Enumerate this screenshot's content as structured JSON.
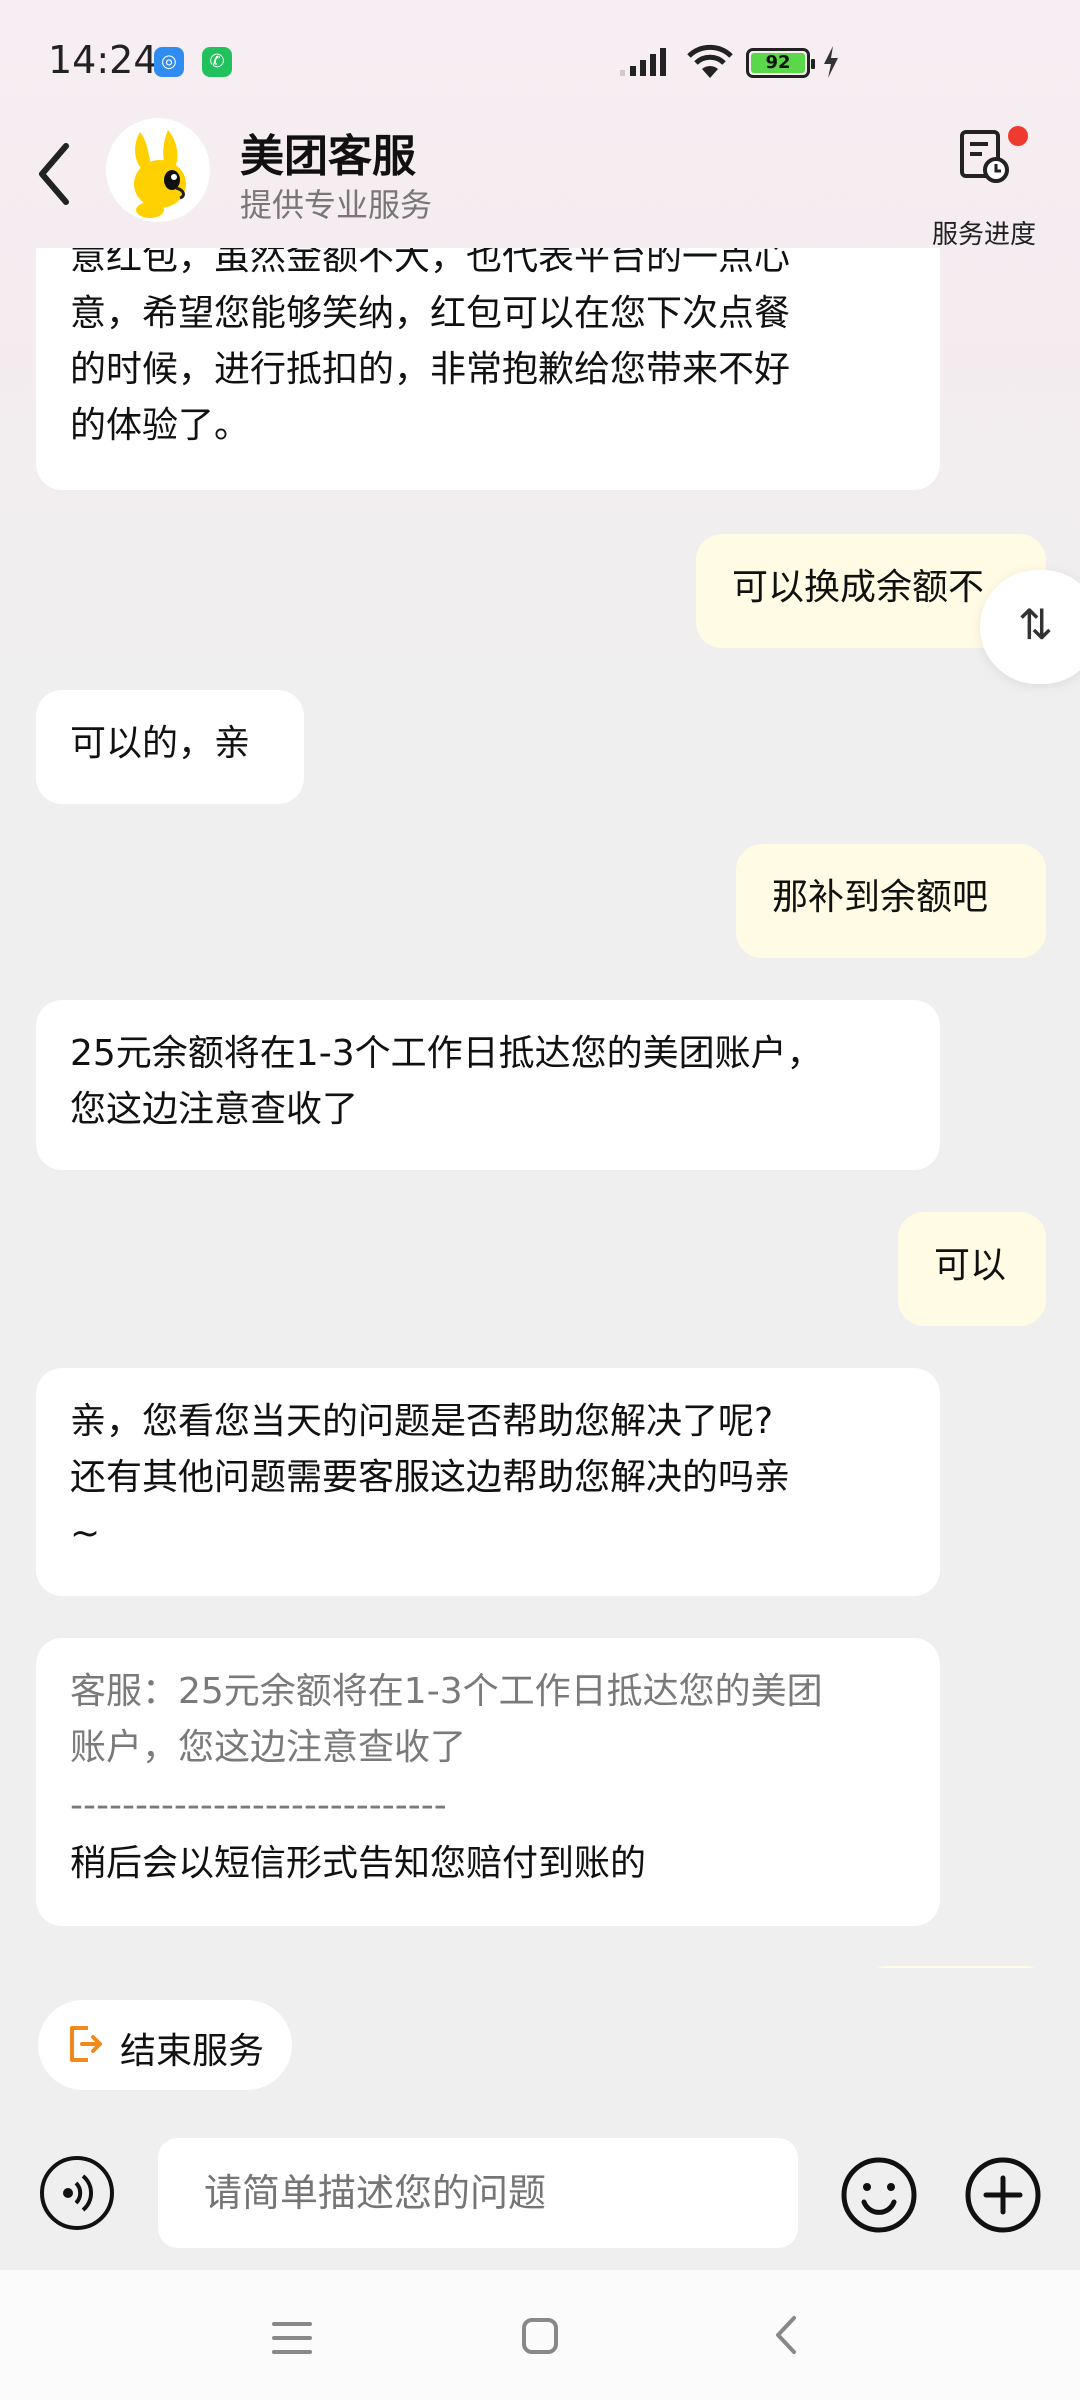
{
  "status_bar": {
    "time": "14:24",
    "battery": "92",
    "battery_level_percent": 92
  },
  "header": {
    "title": "美团客服",
    "subtitle": "提供专业服务",
    "progress_label": "服务进度"
  },
  "messages": [
    {
      "side": "in",
      "lines": [
        "意红包，虽然金额不大，也代表平台的一点心",
        "意，希望您能够笑纳，红包可以在您下次点餐",
        "的时候，进行抵扣的，非常抱歉给您带来不好",
        "的体验了。"
      ]
    },
    {
      "side": "out",
      "lines": [
        "可以换成余额不"
      ]
    },
    {
      "side": "in",
      "lines": [
        "可以的，亲"
      ]
    },
    {
      "side": "out",
      "lines": [
        "那补到余额吧"
      ]
    },
    {
      "side": "in",
      "lines": [
        "25元余额将在1-3个工作日抵达您的美团账户，",
        "您这边注意查收了"
      ]
    },
    {
      "side": "out",
      "lines": [
        "可以"
      ]
    },
    {
      "side": "in",
      "lines": [
        "亲，您看您当天的问题是否帮助您解决了呢?",
        "还有其他问题需要客服这边帮助您解决的吗亲",
        "~"
      ]
    },
    {
      "side": "in",
      "quote_lines": [
        "客服：25元余额将在1-3个工作日抵达您的美团",
        "账户，您这边注意查收了"
      ],
      "divider": "-----------------------------",
      "lines": [
        "稍后会以短信形式告知您赔付到账的"
      ]
    }
  ],
  "scroll_icon": "swap-vertical-icon",
  "footer": {
    "end_service_label": "结束服务",
    "input_placeholder": "请简单描述您的问题"
  },
  "colors": {
    "incoming_bubble": "#ffffff",
    "outgoing_bubble": "#fffbe4",
    "brand_yellow": "#ffd100",
    "notification_dot": "#ef3a30",
    "end_icon_orange": "#f08a1c"
  }
}
